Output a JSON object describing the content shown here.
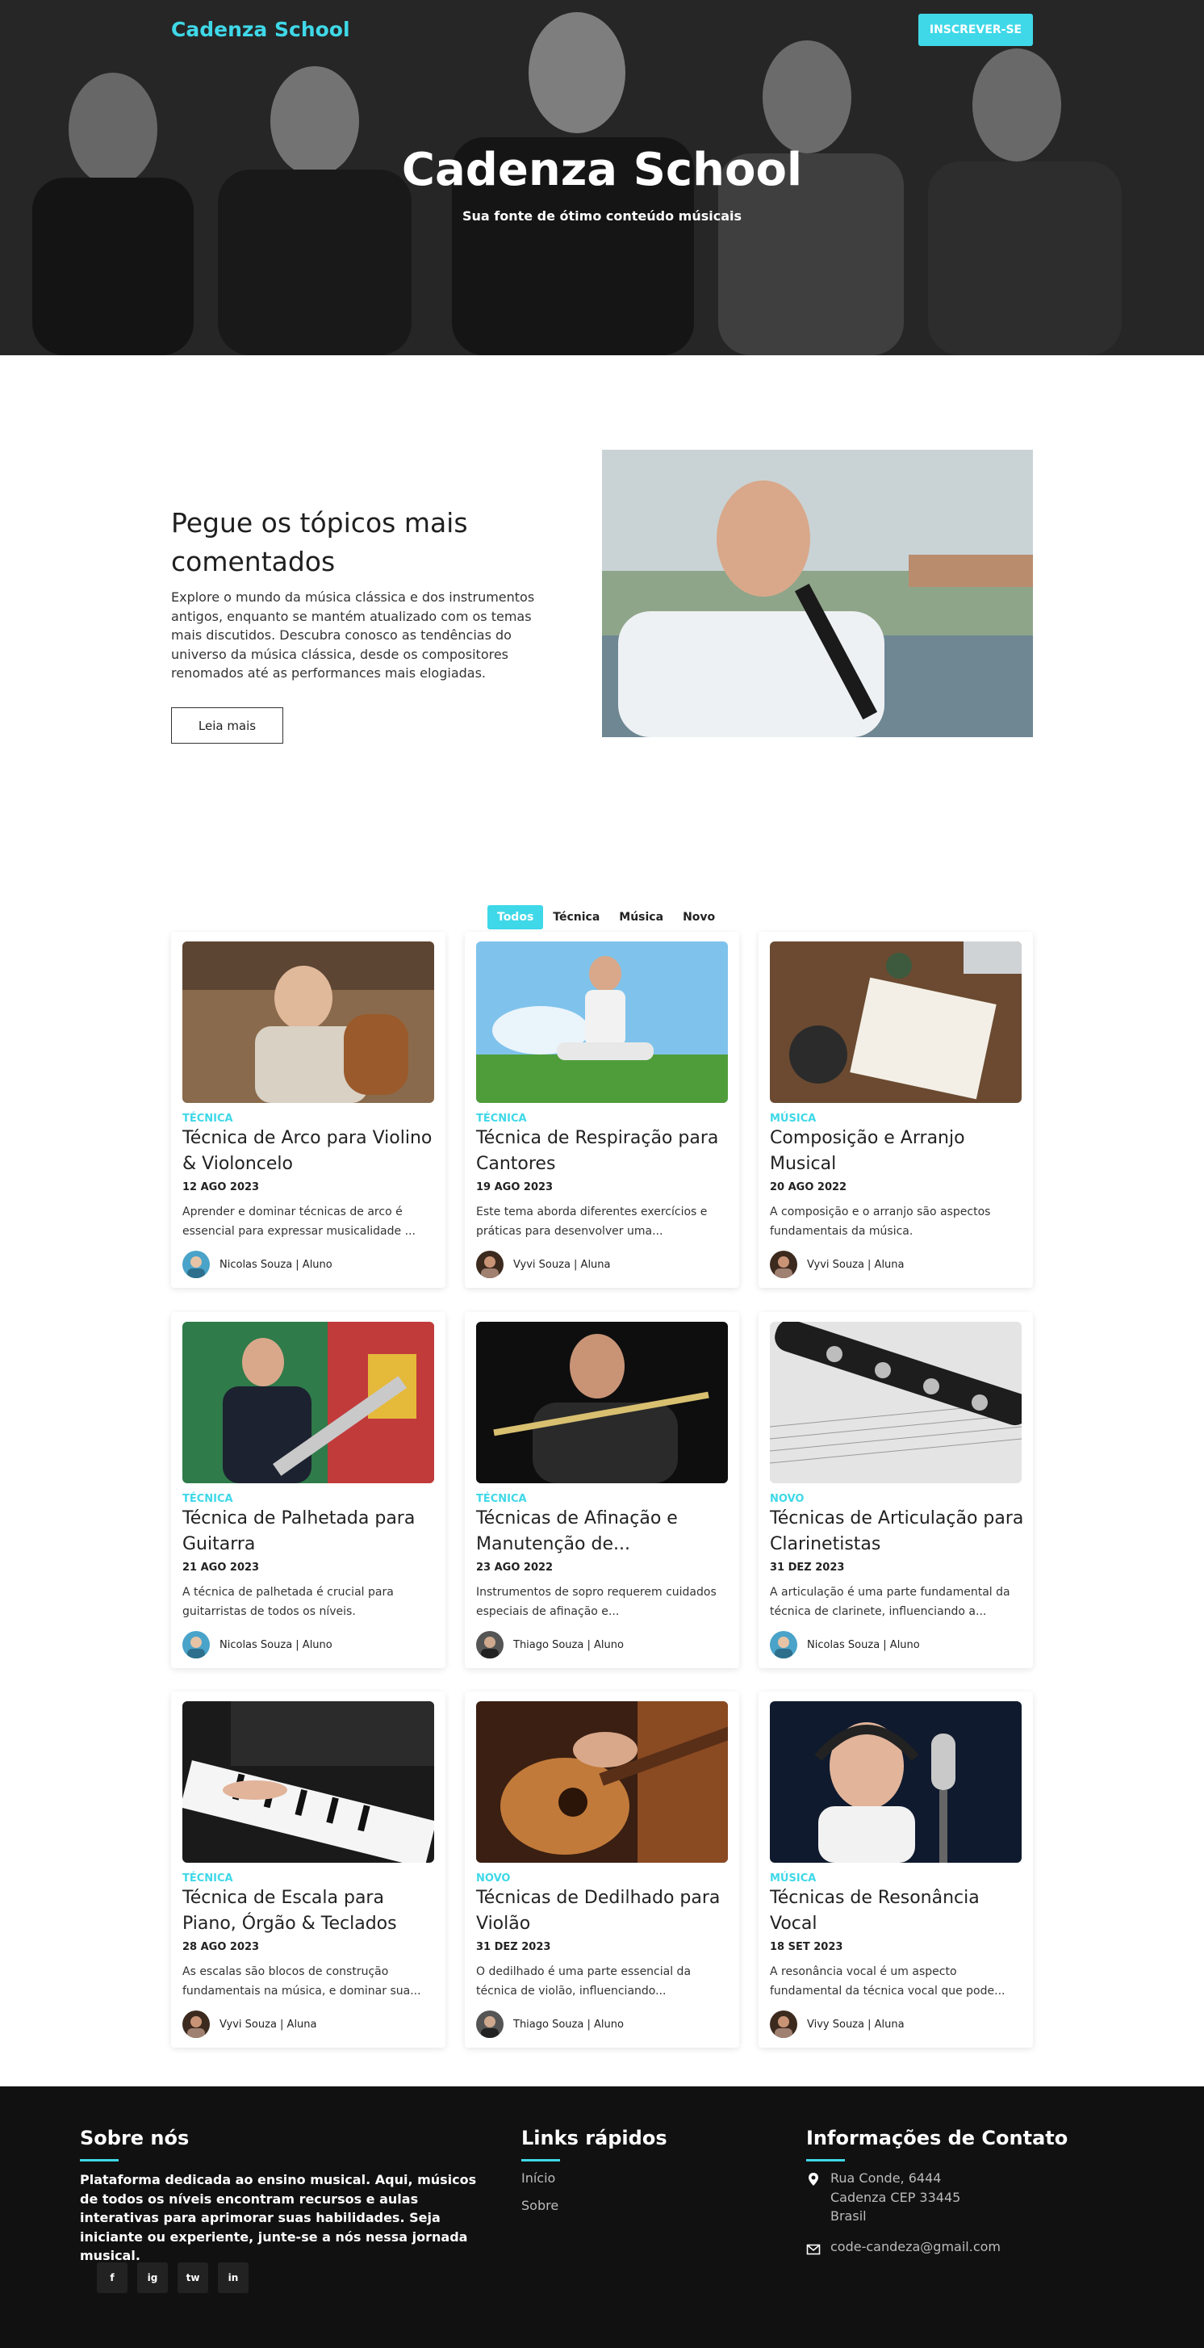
{
  "header": {
    "brand": "Cadenza School",
    "signup_label": "INSCREVER-SE",
    "hero_title": "Cadenza School",
    "hero_subtitle": "Sua fonte de ótimo conteúdo músicais"
  },
  "feature": {
    "title": "Pegue os tópicos mais comentados",
    "text": "Explore o mundo da música clássica e dos instrumentos antigos, enquanto se mantém atualizado com os temas mais discutidos. Descubra conosco as tendências do universo da música clássica, desde os compositores renomados até as performances mais elogiadas.",
    "button_label": "Leia mais"
  },
  "filters": [
    "Todos",
    "Técnica",
    "Música",
    "Novo"
  ],
  "cards": [
    {
      "category": "TÉCNICA",
      "title": "Técnica de Arco para Violino & Violoncelo",
      "date": "12 AGO 2023",
      "desc": "Aprender e dominar técnicas de arco é essencial para expressar musicalidade ...",
      "author": "Nicolas Souza | Aluno"
    },
    {
      "category": "TÉCNICA",
      "title": "Técnica de Respiração para Cantores",
      "date": "19 AGO 2023",
      "desc": "Este tema aborda diferentes exercícios e práticas para desenvolver uma...",
      "author": "Vyvi Souza | Aluna"
    },
    {
      "category": "MÚSICA",
      "title": "Composição e Arranjo Musical",
      "date": "20 AGO 2022",
      "desc": "A composição e o arranjo são aspectos fundamentais da música.",
      "author": "Vyvi Souza | Aluna"
    },
    {
      "category": "TÉCNICA",
      "title": "Técnica de Palhetada para Guitarra",
      "date": "21 AGO 2023",
      "desc": "A técnica de palhetada é crucial para guitarristas de todos os níveis.",
      "author": "Nicolas Souza | Aluno"
    },
    {
      "category": "TÉCNICA",
      "title": "Técnicas de Afinação e Manutenção de...",
      "date": "23 AGO 2022",
      "desc": "Instrumentos de sopro requerem cuidados especiais de afinação e...",
      "author": "Thiago Souza | Aluno"
    },
    {
      "category": "NOVO",
      "title": "Técnicas de Articulação para Clarinetistas",
      "date": "31 DEZ 2023",
      "desc": "A articulação é uma parte fundamental da técnica de clarinete, influenciando a...",
      "author": "Nicolas Souza | Aluno"
    },
    {
      "category": "TÉCNICA",
      "title": "Técnica de Escala para Piano, Órgão & Teclados",
      "date": "28 AGO 2023",
      "desc": "As escalas são blocos de construção fundamentais na música, e dominar sua...",
      "author": "Vyvi Souza | Aluna"
    },
    {
      "category": "NOVO",
      "title": "Técnicas de Dedilhado para Violão",
      "date": "31 DEZ 2023",
      "desc": "O dedilhado é uma parte essencial da técnica de violão, influenciando...",
      "author": "Thiago Souza | Aluno"
    },
    {
      "category": "MÚSICA",
      "title": "Técnicas de Resonância Vocal",
      "date": "18 SET 2023",
      "desc": "A resonância vocal é um aspecto fundamental da técnica vocal que pode...",
      "author": "Vivy Souza | Aluna"
    }
  ],
  "footer": {
    "about_title": "Sobre nós",
    "about_text": "Plataforma dedicada ao ensino musical. Aqui, músicos de todos os níveis encontram recursos e aulas interativas para aprimorar suas habilidades. Seja iniciante ou experiente, junte-se a nós nessa jornada musical.",
    "socials": [
      "f",
      "ig",
      "tw",
      "in"
    ],
    "links_title": "Links rápidos",
    "links": [
      "Início",
      "Sobre"
    ],
    "contact_title": "Informações de Contato",
    "address_line1": "Rua Conde, 6444",
    "address_line2": "Cadenza CEP 33445",
    "address_line3": "Brasil",
    "email": "code-candeza@gmail.com"
  },
  "colors": {
    "accent": "#3fd8e8",
    "footer_bg": "#111111"
  }
}
